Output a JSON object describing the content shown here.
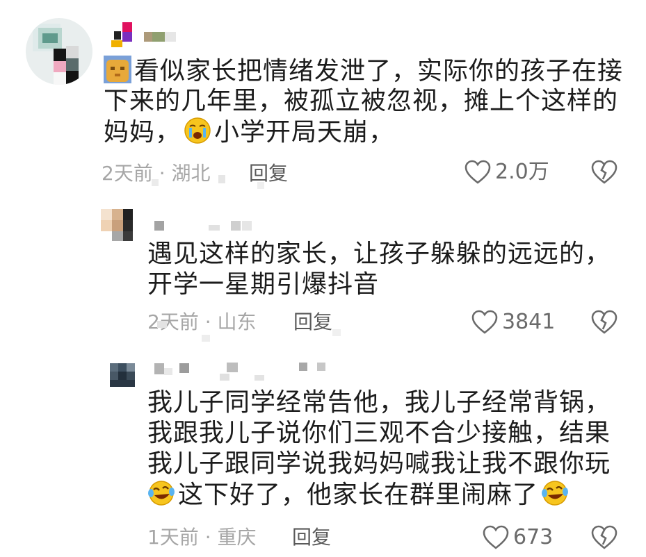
{
  "comments": [
    {
      "text_lines": [
        "看似家长把情绪发泄了，实际你的孩子在接",
        "下来的几年里，被孤立被忽视，摊上个这样的",
        "妈妈，",
        "小学开局天崩，"
      ],
      "time": "2天前",
      "location": "湖北",
      "reply_label": "回复",
      "likes": "2.0万"
    },
    {
      "text_lines": [
        "遇见这样的家长，让孩子躲躲的远远的，",
        "开学一星期引爆抖音"
      ],
      "time": "2天前",
      "location": "山东",
      "reply_label": "回复",
      "likes": "3841"
    },
    {
      "text_lines": [
        "我儿子同学经常告他，我儿子经常背锅，",
        "我跟我儿子说你们三观不合少接触，结果",
        "我儿子跟同学说我妈妈喊我让我不跟你玩",
        "这下好了，他家长在群里闹麻了"
      ],
      "time": "1天前",
      "location": "重庆",
      "reply_label": "回复",
      "likes": "673"
    }
  ],
  "icons": {
    "like": "heart-outline-icon",
    "dislike": "broken-heart-icon",
    "emoji_crying": "crying-face-emoji-icon",
    "emoji_laughing": "tears-of-joy-emoji-icon",
    "cat": "cat-face-icon"
  },
  "colors": {
    "text": "#1c1c1c",
    "meta": "#a6a6a6",
    "reply": "#5a5a5a",
    "icon": "#6a6a6a"
  }
}
